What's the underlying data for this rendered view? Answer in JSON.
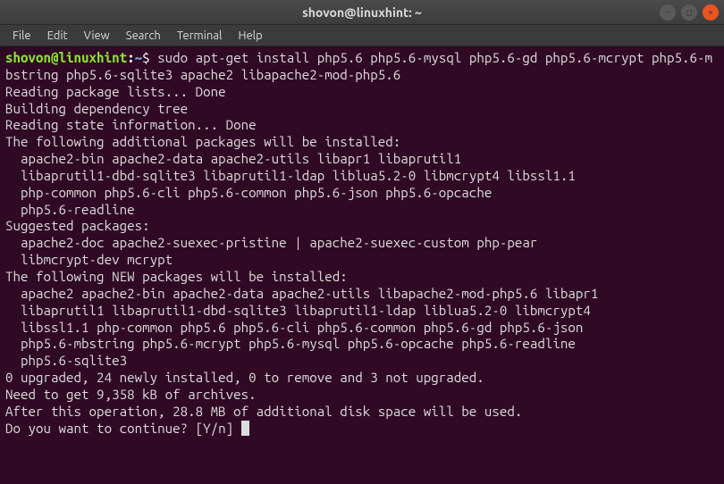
{
  "titlebar": {
    "title": "shovon@linuxhint: ~"
  },
  "window_controls": {
    "minimize": "–",
    "maximize": "□",
    "close": "×"
  },
  "menubar": {
    "items": [
      "File",
      "Edit",
      "View",
      "Search",
      "Terminal",
      "Help"
    ]
  },
  "prompt": {
    "user_host": "shovon@linuxhint",
    "colon": ":",
    "path": "~",
    "dollar": "$ "
  },
  "command": "sudo apt-get install php5.6 php5.6-mysql php5.6-gd php5.6-mcrypt php5.6-mbstring php5.6-sqlite3 apache2 libapache2-mod-php5.6",
  "output_lines": [
    "Reading package lists... Done",
    "Building dependency tree",
    "Reading state information... Done",
    "The following additional packages will be installed:",
    "  apache2-bin apache2-data apache2-utils libapr1 libaprutil1",
    "  libaprutil1-dbd-sqlite3 libaprutil1-ldap liblua5.2-0 libmcrypt4 libssl1.1",
    "  php-common php5.6-cli php5.6-common php5.6-json php5.6-opcache",
    "  php5.6-readline",
    "Suggested packages:",
    "  apache2-doc apache2-suexec-pristine | apache2-suexec-custom php-pear",
    "  libmcrypt-dev mcrypt",
    "The following NEW packages will be installed:",
    "  apache2 apache2-bin apache2-data apache2-utils libapache2-mod-php5.6 libapr1",
    "  libaprutil1 libaprutil1-dbd-sqlite3 libaprutil1-ldap liblua5.2-0 libmcrypt4",
    "  libssl1.1 php-common php5.6 php5.6-cli php5.6-common php5.6-gd php5.6-json",
    "  php5.6-mbstring php5.6-mcrypt php5.6-mysql php5.6-opcache php5.6-readline",
    "  php5.6-sqlite3",
    "0 upgraded, 24 newly installed, 0 to remove and 3 not upgraded.",
    "Need to get 9,358 kB of archives.",
    "After this operation, 28.8 MB of additional disk space will be used.",
    "Do you want to continue? [Y/n] "
  ]
}
